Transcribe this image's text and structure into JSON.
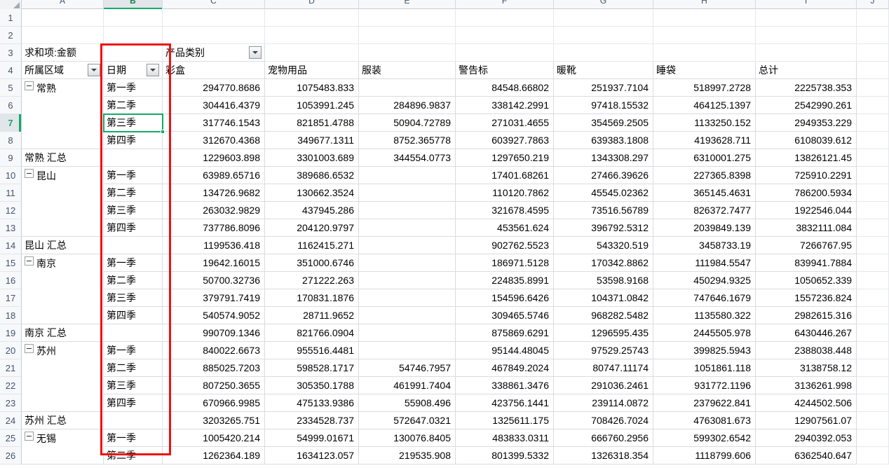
{
  "app": {
    "type": "spreadsheet-pivot-table"
  },
  "colors": {
    "accent": "#13ab67",
    "annotation": "#ee1111",
    "header_bg": "#f7f8fa",
    "grid_line": "#d9dce1"
  },
  "columns": {
    "letters": [
      "A",
      "B",
      "C",
      "D",
      "E",
      "F",
      "G",
      "H",
      "I",
      "J"
    ],
    "selected": "B"
  },
  "rows": {
    "numbers": [
      "1",
      "2",
      "3",
      "4",
      "5",
      "6",
      "7",
      "8",
      "9",
      "10",
      "11",
      "12",
      "13",
      "14",
      "15",
      "16",
      "17",
      "18",
      "19",
      "20",
      "21",
      "22",
      "23",
      "24",
      "25",
      "26"
    ],
    "selected": "7"
  },
  "pivot": {
    "value_field_label": "求和项:金额",
    "column_field_label": "产品类别",
    "row_field_label": "所属区域",
    "second_field_label": "日期",
    "filter_icon": "chevron-down-icon"
  },
  "table": {
    "headers": [
      "所属区域",
      "日期",
      "彩盒",
      "宠物用品",
      "服装",
      "警告标",
      "暖靴",
      "睡袋",
      "总计"
    ],
    "rows": [
      {
        "row": "5",
        "region": "常熟",
        "expander": true,
        "quarter": "第一季",
        "values": [
          "294770.8686",
          "1075483.833",
          "",
          "84548.66802",
          "251937.7104",
          "518997.2728",
          "2225738.353"
        ]
      },
      {
        "row": "6",
        "region": "",
        "expander": false,
        "quarter": "第二季",
        "values": [
          "304416.4379",
          "1053991.245",
          "284896.9837",
          "338142.2991",
          "97418.15532",
          "464125.1397",
          "2542990.261"
        ]
      },
      {
        "row": "7",
        "region": "",
        "expander": false,
        "quarter": "第三季",
        "values": [
          "317746.1543",
          "821851.4788",
          "50904.72789",
          "271031.4655",
          "354569.2505",
          "1133250.152",
          "2949353.229"
        ]
      },
      {
        "row": "8",
        "region": "",
        "expander": false,
        "quarter": "第四季",
        "values": [
          "312670.4368",
          "349677.1311",
          "8752.365778",
          "603927.7863",
          "639383.1808",
          "4193628.711",
          "6108039.612"
        ]
      },
      {
        "row": "9",
        "region": "常熟 汇总",
        "subtotal": true,
        "quarter": "",
        "values": [
          "1229603.898",
          "3301003.689",
          "344554.0773",
          "1297650.219",
          "1343308.297",
          "6310001.275",
          "13826121.45"
        ]
      },
      {
        "row": "10",
        "region": "昆山",
        "expander": true,
        "quarter": "第一季",
        "values": [
          "63989.65716",
          "389686.6532",
          "",
          "17401.68261",
          "27466.39626",
          "227365.8398",
          "725910.2291"
        ]
      },
      {
        "row": "11",
        "region": "",
        "expander": false,
        "quarter": "第二季",
        "values": [
          "134726.9682",
          "130662.3524",
          "",
          "110120.7862",
          "45545.02362",
          "365145.4631",
          "786200.5934"
        ]
      },
      {
        "row": "12",
        "region": "",
        "expander": false,
        "quarter": "第三季",
        "values": [
          "263032.9829",
          "437945.286",
          "",
          "321678.4595",
          "73516.56789",
          "826372.7477",
          "1922546.044"
        ]
      },
      {
        "row": "13",
        "region": "",
        "expander": false,
        "quarter": "第四季",
        "values": [
          "737786.8096",
          "204120.9797",
          "",
          "453561.624",
          "396792.5312",
          "2039849.139",
          "3832111.084"
        ]
      },
      {
        "row": "14",
        "region": "昆山 汇总",
        "subtotal": true,
        "quarter": "",
        "values": [
          "1199536.418",
          "1162415.271",
          "",
          "902762.5523",
          "543320.519",
          "3458733.19",
          "7266767.95"
        ]
      },
      {
        "row": "15",
        "region": "南京",
        "expander": true,
        "quarter": "第一季",
        "values": [
          "19642.16015",
          "351000.6746",
          "",
          "186971.5128",
          "170342.8862",
          "111984.5547",
          "839941.7884"
        ]
      },
      {
        "row": "16",
        "region": "",
        "expander": false,
        "quarter": "第二季",
        "values": [
          "50700.32736",
          "271222.263",
          "",
          "224835.8991",
          "53598.9168",
          "450294.9325",
          "1050652.339"
        ]
      },
      {
        "row": "17",
        "region": "",
        "expander": false,
        "quarter": "第三季",
        "values": [
          "379791.7419",
          "170831.1876",
          "",
          "154596.6426",
          "104371.0842",
          "747646.1679",
          "1557236.824"
        ]
      },
      {
        "row": "18",
        "region": "",
        "expander": false,
        "quarter": "第四季",
        "values": [
          "540574.9052",
          "28711.9652",
          "",
          "309465.5746",
          "968282.5482",
          "1135580.322",
          "2982615.316"
        ]
      },
      {
        "row": "19",
        "region": "南京 汇总",
        "subtotal": true,
        "quarter": "",
        "values": [
          "990709.1346",
          "821766.0904",
          "",
          "875869.6291",
          "1296595.435",
          "2445505.978",
          "6430446.267"
        ]
      },
      {
        "row": "20",
        "region": "苏州",
        "expander": true,
        "quarter": "第一季",
        "values": [
          "840022.6673",
          "955516.4481",
          "",
          "95144.48045",
          "97529.25743",
          "399825.5943",
          "2388038.448"
        ]
      },
      {
        "row": "21",
        "region": "",
        "expander": false,
        "quarter": "第二季",
        "values": [
          "885025.7203",
          "598528.1717",
          "54746.7957",
          "467849.2024",
          "80747.11174",
          "1051861.118",
          "3138758.12"
        ]
      },
      {
        "row": "22",
        "region": "",
        "expander": false,
        "quarter": "第三季",
        "values": [
          "807250.3655",
          "305350.1788",
          "461991.7404",
          "338861.3476",
          "291036.2461",
          "931772.1196",
          "3136261.998"
        ]
      },
      {
        "row": "23",
        "region": "",
        "expander": false,
        "quarter": "第四季",
        "values": [
          "670966.9985",
          "475133.9386",
          "55908.496",
          "423756.1441",
          "239114.0872",
          "2379622.841",
          "4244502.506"
        ]
      },
      {
        "row": "24",
        "region": "苏州 汇总",
        "subtotal": true,
        "quarter": "",
        "values": [
          "3203265.751",
          "2334528.737",
          "572647.0321",
          "1325611.175",
          "708426.7024",
          "4763081.673",
          "12907561.07"
        ]
      },
      {
        "row": "25",
        "region": "无锡",
        "expander": true,
        "quarter": "第一季",
        "values": [
          "1005420.214",
          "54999.01671",
          "130076.8405",
          "483833.0311",
          "666760.2956",
          "599302.6542",
          "2940392.053"
        ]
      },
      {
        "row": "26",
        "region": "",
        "expander": false,
        "quarter": "第二季",
        "values": [
          "1262364.189",
          "1634123.057",
          "219535.908",
          "801399.5332",
          "1326318.354",
          "1118799.606",
          "6362540.647"
        ]
      }
    ]
  },
  "annotations": {
    "red_rectangle": {
      "label": "date-column-highlight"
    },
    "active_cell": {
      "label": "B7",
      "value": "第三季"
    }
  }
}
